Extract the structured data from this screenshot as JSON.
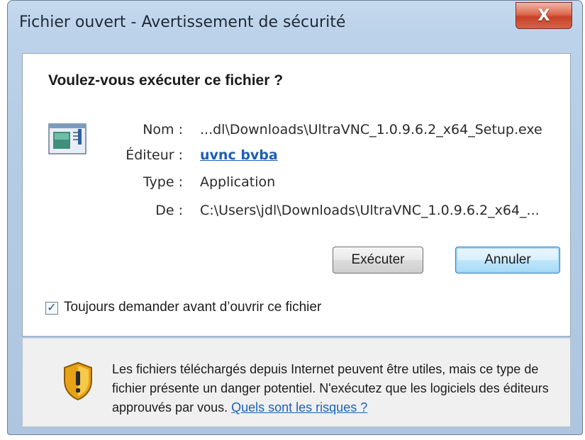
{
  "window": {
    "title": "Fichier ouvert - Avertissement de sécurité",
    "close_symbol": "X"
  },
  "dialog": {
    "question": "Voulez-vous exécuter ce fichier ?",
    "file_icon": "application-window-icon",
    "fields": {
      "name_label": "Nom :",
      "name_value": "...dl\\Downloads\\UltraVNC_1.0.9.6.2_x64_Setup.exe",
      "publisher_label": "Éditeur :",
      "publisher_value": "uvnc bvba",
      "type_label": "Type :",
      "type_value": "Application",
      "from_label": "De :",
      "from_value": "C:\\Users\\jdl\\Downloads\\UltraVNC_1.0.9.6.2_x64_..."
    },
    "buttons": {
      "run": "Exécuter",
      "cancel": "Annuler"
    },
    "always_ask": {
      "checked": true,
      "label": "Toujours demander avant d’ouvrir ce fichier"
    }
  },
  "footer": {
    "icon": "shield-warning-icon",
    "warning_text": "Les fichiers téléchargés depuis Internet peuvent être utiles, mais ce type de fichier présente un danger potentiel. N'exécutez que les logiciels des éditeurs approuvés par vous.",
    "risk_link": "Quels sont les risques ?"
  },
  "colors": {
    "link": "#1e5fb7",
    "close_button": "#c84128",
    "frame": "#b4cbe5"
  }
}
